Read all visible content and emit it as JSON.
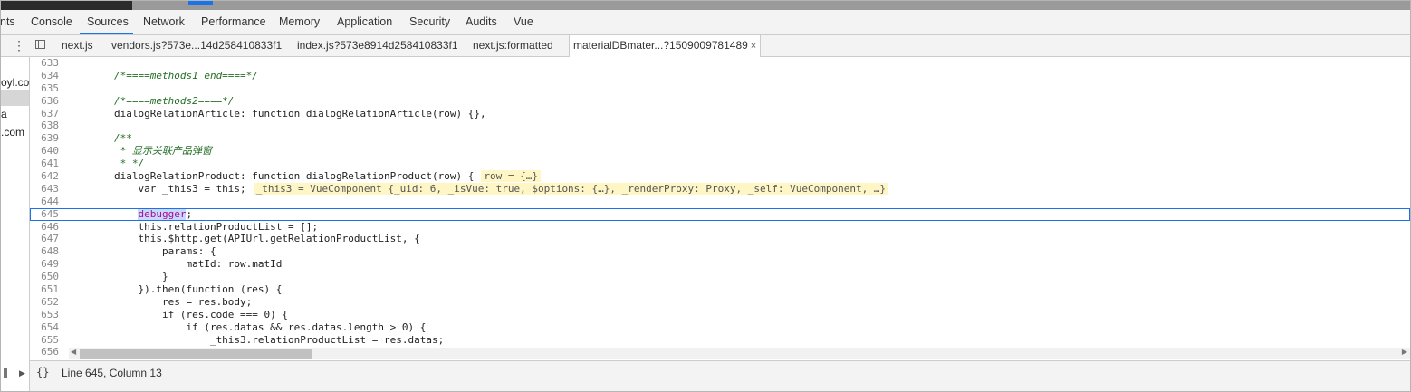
{
  "devtools_tabs": [
    {
      "label": "nts",
      "active": false
    },
    {
      "label": "Console",
      "active": false
    },
    {
      "label": "Sources",
      "active": true
    },
    {
      "label": "Network",
      "active": false
    },
    {
      "label": "Performance",
      "active": false
    },
    {
      "label": "Memory",
      "active": false
    },
    {
      "label": "Application",
      "active": false
    },
    {
      "label": "Security",
      "active": false
    },
    {
      "label": "Audits",
      "active": false
    },
    {
      "label": "Vue",
      "active": false
    }
  ],
  "file_tabs": [
    {
      "label": "next.js"
    },
    {
      "label": "vendors.js?573e...14d258410833f1"
    },
    {
      "label": "index.js?573e8914d258410833f1"
    },
    {
      "label": "next.js:formatted"
    },
    {
      "label": "materialDBmater...?1509009781489",
      "active": true,
      "close": "×"
    }
  ],
  "left_pane": {
    "items": [
      "oyl.co",
      "",
      "a",
      ".com"
    ]
  },
  "code_lines": [
    {
      "n": "633",
      "text": ""
    },
    {
      "n": "634",
      "text": "        /*====methods1 end====*/"
    },
    {
      "n": "635",
      "text": ""
    },
    {
      "n": "636",
      "text": "        /*====methods2====*/"
    },
    {
      "n": "637",
      "text": "        dialogRelationArticle: function dialogRelationArticle(row) {},"
    },
    {
      "n": "638",
      "text": ""
    },
    {
      "n": "639",
      "text": "        /**"
    },
    {
      "n": "640",
      "text": "         * 显示关联产品弹窗"
    },
    {
      "n": "641",
      "text": "         * */"
    },
    {
      "n": "642",
      "text": "        dialogRelationProduct: function dialogRelationProduct(row) {",
      "inline": "row = {…}"
    },
    {
      "n": "643",
      "text": "            var _this3 = this;",
      "inline": "_this3 = VueComponent {_uid: 6, _isVue: true, $options: {…}, _renderProxy: Proxy, _self: VueComponent, …}"
    },
    {
      "n": "644",
      "text": ""
    },
    {
      "n": "645",
      "text": "            debugger;",
      "current": true
    },
    {
      "n": "646",
      "text": "            this.relationProductList = [];"
    },
    {
      "n": "647",
      "text": "            this.$http.get(APIUrl.getRelationProductList, {"
    },
    {
      "n": "648",
      "text": "                params: {"
    },
    {
      "n": "649",
      "text": "                    matId: row.matId"
    },
    {
      "n": "650",
      "text": "                }"
    },
    {
      "n": "651",
      "text": "            }).then(function (res) {"
    },
    {
      "n": "652",
      "text": "                res = res.body;"
    },
    {
      "n": "653",
      "text": "                if (res.code === 0) {"
    },
    {
      "n": "654",
      "text": "                    if (res.datas && res.datas.length > 0) {"
    },
    {
      "n": "655",
      "text": "                        _this3.relationProductList = res.datas;"
    },
    {
      "n": "656",
      "text": ""
    }
  ],
  "status": {
    "braces": "{}",
    "position": "Line 645, Column 13"
  },
  "colors": {
    "accent": "#1a73e8",
    "comment": "#236e25",
    "keyword": "#aa0d91",
    "inline_value_bg": "#fff6c6"
  }
}
